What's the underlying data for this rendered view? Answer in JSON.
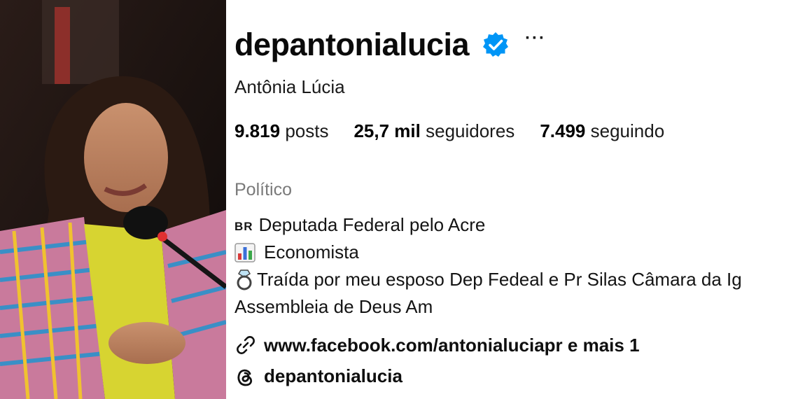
{
  "profile": {
    "username": "depantonialucia",
    "full_name": "Antônia Lúcia",
    "verified_icon": "verified-badge-icon",
    "more_label": "···",
    "stats": [
      {
        "value": "9.819",
        "label": "posts"
      },
      {
        "value": "25,7 mil",
        "label": "seguidores"
      },
      {
        "value": "7.499",
        "label": "seguindo"
      }
    ],
    "category": "Político",
    "bio": {
      "line1_flag": "BR",
      "line1_text": "Deputada Federal pelo Acre",
      "line2_text": "Economista",
      "line3_text": "Traída por meu esposo Dep Fedeal e Pr Silas Câmara da Ig",
      "line4_text": "Assembleia de Deus Am"
    },
    "link": {
      "text": "www.facebook.com/antonialuciapr e mais 1",
      "icon": "link-icon"
    },
    "threads": {
      "text": "depantonialucia",
      "icon": "threads-icon"
    }
  },
  "colors": {
    "verified_blue": "#0095f6",
    "category_gray": "#7a7a7a",
    "text": "#0f0f0f"
  }
}
